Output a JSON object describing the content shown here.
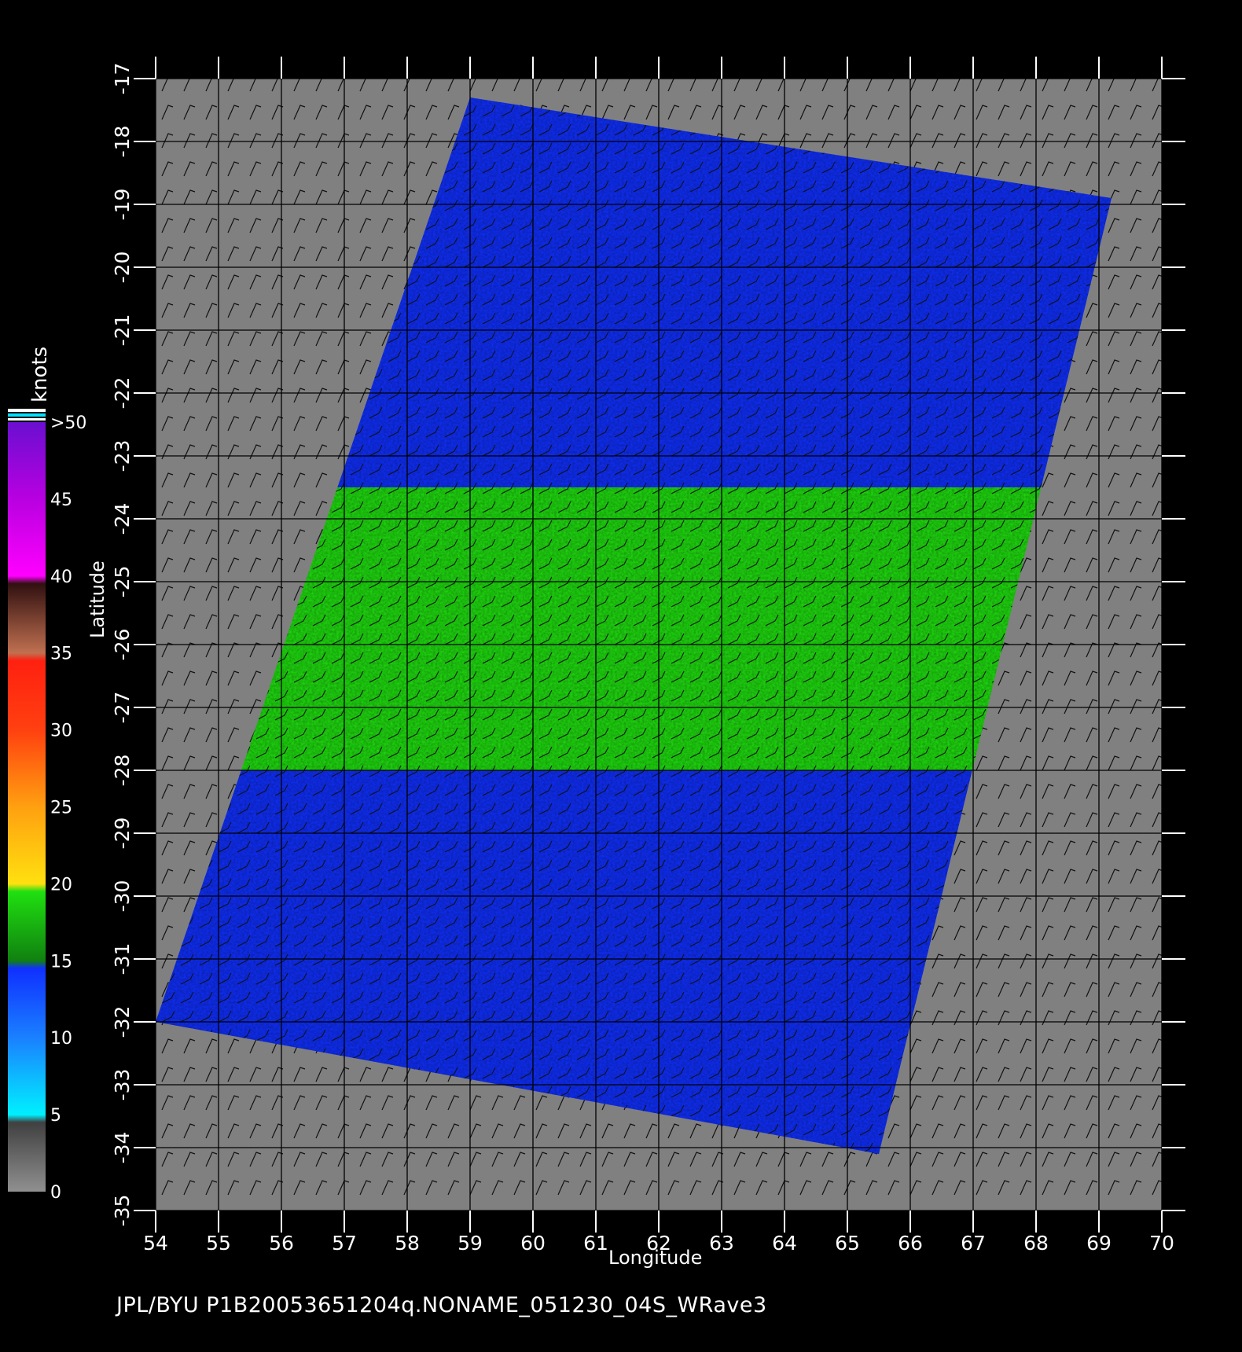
{
  "map": {
    "x_axis_title": "Longitude",
    "y_axis_title": "Latitude",
    "longitude_ticks": [
      "54",
      "55",
      "56",
      "57",
      "58",
      "59",
      "60",
      "61",
      "62",
      "63",
      "64",
      "65",
      "66",
      "67",
      "68",
      "69",
      "70"
    ],
    "latitude_ticks": [
      "-17",
      "-18",
      "-19",
      "-20",
      "-21",
      "-22",
      "-23",
      "-24",
      "-25",
      "-26",
      "-27",
      "-28",
      "-29",
      "-30",
      "-31",
      "-32",
      "-33",
      "-34",
      "-35"
    ],
    "footer": "JPL/BYU  P1B20053651204q.NONAME_051230_04S_WRave3",
    "no_data_color": "#808080",
    "swath_corners_lonlat": [
      [
        59.0,
        -17.3
      ],
      [
        69.2,
        -18.9
      ],
      [
        65.5,
        -34.1
      ],
      [
        54.0,
        -32.0
      ]
    ],
    "wind_bands": [
      {
        "lat_min": -21.0,
        "lat_max": -17.3,
        "speed_knots": 13
      },
      {
        "lat_min": -23.5,
        "lat_max": -21.0,
        "speed_knots": 11
      },
      {
        "lat_min": -28.0,
        "lat_max": -23.5,
        "speed_knots": 18
      },
      {
        "lat_min": -34.2,
        "lat_max": -28.0,
        "speed_knots": 14
      }
    ]
  },
  "colorbar": {
    "units": "knots",
    "labels": [
      ">50",
      "45",
      "40",
      "35",
      "30",
      "25",
      "20",
      "15",
      "10",
      "5",
      "0"
    ],
    "stops": [
      {
        "at": 0.0,
        "color": "#6a0fd0"
      },
      {
        "at": 0.1,
        "color": "#b800e0"
      },
      {
        "at": 0.2,
        "color": "#ff00ff"
      },
      {
        "at": 0.21,
        "color": "#301010"
      },
      {
        "at": 0.3,
        "color": "#c07050"
      },
      {
        "at": 0.31,
        "color": "#ff2010"
      },
      {
        "at": 0.4,
        "color": "#ff4010"
      },
      {
        "at": 0.5,
        "color": "#ffa010"
      },
      {
        "at": 0.6,
        "color": "#ffe010"
      },
      {
        "at": 0.61,
        "color": "#20e010"
      },
      {
        "at": 0.7,
        "color": "#108010"
      },
      {
        "at": 0.71,
        "color": "#1030ff"
      },
      {
        "at": 0.8,
        "color": "#1a80ff"
      },
      {
        "at": 0.9,
        "color": "#00f0ff"
      },
      {
        "at": 0.91,
        "color": "#404040"
      },
      {
        "at": 1.0,
        "color": "#909090"
      }
    ]
  }
}
